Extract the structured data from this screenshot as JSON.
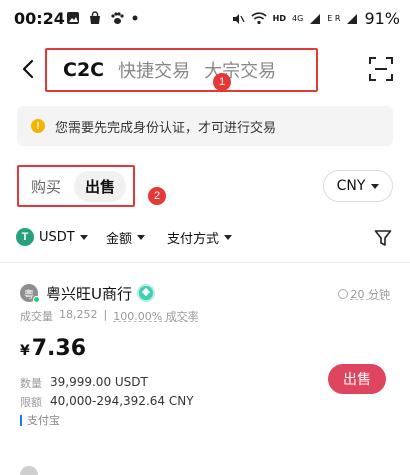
{
  "status_bar": {
    "time": "00:24",
    "network": "HD",
    "signal_1": "4G",
    "signal_2": "E R",
    "battery": "91%"
  },
  "header": {
    "tabs": [
      {
        "label": "C2C",
        "active": true
      },
      {
        "label": "快捷交易",
        "active": false
      },
      {
        "label": "大宗交易",
        "active": false
      }
    ],
    "marker": "1"
  },
  "notice": {
    "icon": "!",
    "text": "您需要先完成身份认证，才可进行交易"
  },
  "trade_side": {
    "buy_label": "购买",
    "sell_label": "出售",
    "selected": "出售",
    "marker": "2"
  },
  "currency": {
    "selected": "CNY"
  },
  "filters": {
    "coin": "USDT",
    "coin_logo": "T",
    "amount": "金额",
    "payment": "支付方式"
  },
  "listing": {
    "avatar": "粤",
    "merchant": "粤兴旺U商行",
    "pay_time": "20 分钟",
    "volume_label": "成交量",
    "volume_value": "18,252",
    "completion": "100.00% 成交率",
    "currency_symbol": "¥",
    "price": "7.36",
    "quantity_label": "数量",
    "quantity_value": "39,999.00 USDT",
    "limit_label": "限额",
    "limit_value": "40,000-294,392.64 CNY",
    "payment_method": "支付宝",
    "action_label": "出售"
  },
  "colors": {
    "accent_red": "#e53935",
    "sell_button": "#e0455f",
    "usdt_green": "#26a17b",
    "verified": "#3ccfb0",
    "alipay_blue": "#1677ff"
  },
  "icons": {
    "back": "chevron-left-icon",
    "scan": "scan-icon",
    "filter": "funnel-icon",
    "notice": "warning-icon",
    "clock": "clock-icon"
  }
}
